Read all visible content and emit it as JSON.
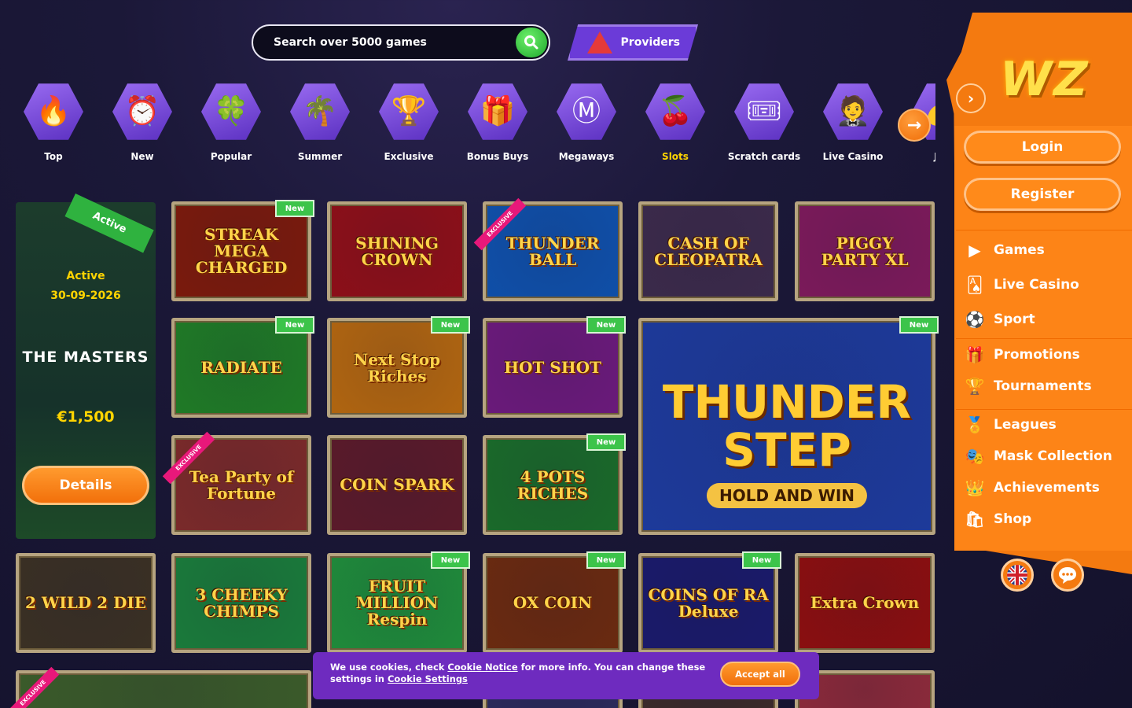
{
  "search": {
    "placeholder": "Search over 5000 games"
  },
  "providers": {
    "label": "Providers"
  },
  "categories": [
    {
      "label": "Top",
      "icon": "flame-icon",
      "glyph": "🔥",
      "color": "#7d4be0"
    },
    {
      "label": "New",
      "icon": "alarm-clock-icon",
      "glyph": "⏰",
      "color": "#7d4be0"
    },
    {
      "label": "Popular",
      "icon": "clover-icon",
      "glyph": "🍀",
      "color": "#7d4be0"
    },
    {
      "label": "Summer",
      "icon": "palm-tree-icon",
      "glyph": "🌴",
      "color": "#7d4be0"
    },
    {
      "label": "Exclusive",
      "icon": "trophy-icon",
      "glyph": "🏆",
      "color": "#7d4be0"
    },
    {
      "label": "Bonus Buys",
      "icon": "gift-icon",
      "glyph": "🎁",
      "color": "#7d4be0"
    },
    {
      "label": "Megaways",
      "icon": "megaways-m-icon",
      "glyph": "Ⓜ",
      "color": "#7d4be0"
    },
    {
      "label": "Slots",
      "icon": "cherries-icon",
      "glyph": "🍒",
      "color": "#7d4be0"
    },
    {
      "label": "Scratch cards",
      "icon": "scratch-card-icon",
      "glyph": "🎟",
      "color": "#7d4be0"
    },
    {
      "label": "Live Casino",
      "icon": "dealer-icon",
      "glyph": "🤵",
      "color": "#7d4be0"
    },
    {
      "label": "Jac",
      "icon": "jackpot-icon",
      "glyph": "💰",
      "color": "#7d4be0"
    }
  ],
  "active_category": "Slots",
  "tournament": {
    "ribbon": "Active",
    "status": "Active",
    "date": "30-09-2026",
    "name": "THE MASTERS",
    "prize": "€1,500",
    "details_label": "Details"
  },
  "games": [
    {
      "title": "STREAK MEGA CHARGED",
      "badge": "New",
      "bg": "#7a1a0c"
    },
    {
      "title": "SHINING CROWN",
      "badge": "",
      "bg": "#8c0f18"
    },
    {
      "title": "THUNDER BALL",
      "badge": "",
      "exclusive": "EXCLUSIVE",
      "bg": "#0f4fa8"
    },
    {
      "title": "CASH OF CLEOPATRA",
      "badge": "",
      "bg": "#3b2a4a"
    },
    {
      "title": "PIGGY PARTY XL",
      "badge": "",
      "bg": "#7b1a5a"
    },
    {
      "title": "RADIATE",
      "badge": "New",
      "bg": "#1f7a26"
    },
    {
      "title": "Next Stop Riches",
      "badge": "New",
      "bg": "#b06510"
    },
    {
      "title": "HOT SHOT",
      "badge": "New",
      "bg": "#6a1a7a"
    },
    {
      "title": "THUNDER STEP",
      "subtitle": "HOLD AND WIN",
      "badge": "New",
      "bg": "#1d3a9a"
    },
    {
      "title": "Tea Party of Fortune",
      "badge": "",
      "exclusive": "EXCLUSIVE",
      "bg": "#7a2a2a"
    },
    {
      "title": "COIN SPARK",
      "badge": "",
      "bg": "#5a1a2a"
    },
    {
      "title": "4 POTS RICHES",
      "badge": "New",
      "bg": "#1a6a2a"
    },
    {
      "title": "2 WILD 2 DIE",
      "badge": "",
      "bg": "#3a3024"
    },
    {
      "title": "3 CHEEKY CHIMPS",
      "badge": "",
      "bg": "#1a7a3a"
    },
    {
      "title": "FRUIT MILLION Respin",
      "badge": "New",
      "bg": "#1f8a3a"
    },
    {
      "title": "OX COIN",
      "badge": "New",
      "bg": "#6a2a10"
    },
    {
      "title": "COINS OF RA Deluxe",
      "badge": "New",
      "bg": "#1a1a6a"
    },
    {
      "title": "Extra Crown",
      "badge": "",
      "bg": "#8a0f10"
    },
    {
      "title": "",
      "badge": "",
      "exclusive": "EXCLUSIVE",
      "bg": "#3a5a2a"
    },
    {
      "title": "",
      "badge": "",
      "bg": "#2a2a5a"
    },
    {
      "title": "",
      "badge": "",
      "bg": "#3a2a2a"
    },
    {
      "title": "",
      "badge": "",
      "bg": "#8a2a3a"
    }
  ],
  "cookie": {
    "text_1": "We use cookies, check ",
    "link_1": "Cookie Notice",
    "text_2": " for more info. You can change these settings in ",
    "link_2": "Cookie Settings",
    "accept_label": "Accept all"
  },
  "sidebar": {
    "logo": "WZ",
    "login_label": "Login",
    "register_label": "Register",
    "menu": [
      {
        "label": "Games",
        "icon": "games-play-icon",
        "glyph": "▶"
      },
      {
        "label": "Live Casino",
        "icon": "cards-icon",
        "glyph": "🂡"
      },
      {
        "label": "Sport",
        "icon": "football-icon",
        "glyph": "⚽"
      },
      {
        "label": "Promotions",
        "icon": "gift-icon",
        "glyph": "🎁"
      },
      {
        "label": "Tournaments",
        "icon": "trophy-icon",
        "glyph": "🏆"
      },
      {
        "label": "Leagues",
        "icon": "leagues-icon",
        "glyph": "🏅"
      },
      {
        "label": "Mask Collection",
        "icon": "mask-icon",
        "glyph": "🎭"
      },
      {
        "label": "Achievements",
        "icon": "crown-icon",
        "glyph": "👑"
      },
      {
        "label": "Shop",
        "icon": "shop-bag-icon",
        "glyph": "🛍"
      }
    ],
    "language_icon": "uk-flag-icon",
    "chat_icon": "chat-icon"
  }
}
